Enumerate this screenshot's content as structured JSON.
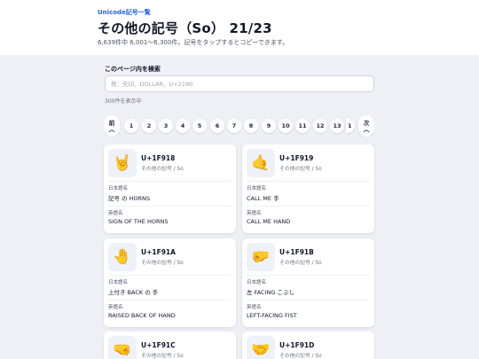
{
  "header": {
    "breadcrumb": "Unicode記号一覧",
    "title": "その他の記号（So） 21/23",
    "subtitle": "6,639件中 6,001〜6,300件。記号をタップするとコピーできます。"
  },
  "search": {
    "label": "このページ内を検索",
    "placeholder": "例：矢印、DOLLAR、U+2190",
    "value": "",
    "count": "300件を表示中"
  },
  "pagination": {
    "prev_label": "前",
    "next_label": "次",
    "pages": [
      "1",
      "2",
      "3",
      "4",
      "5",
      "6",
      "7",
      "8",
      "9",
      "10",
      "11",
      "12",
      "13",
      "1"
    ]
  },
  "labels": {
    "jp_name": "日本語名",
    "en_name": "英語名"
  },
  "cards": [
    {
      "symbol": "🤘",
      "code": "U+1F918",
      "category": "その他の記号 / So",
      "jp": "記号 の HORNS",
      "en": "SIGN OF THE HORNS"
    },
    {
      "symbol": "🤙",
      "code": "U+1F919",
      "category": "その他の記号 / So",
      "jp": "CALL ME 手",
      "en": "CALL ME HAND"
    },
    {
      "symbol": "🤚",
      "code": "U+1F91A",
      "category": "その他の記号 / So",
      "jp": "上付き BACK の 手",
      "en": "RAISED BACK OF HAND"
    },
    {
      "symbol": "🤛",
      "code": "U+1F91B",
      "category": "その他の記号 / So",
      "jp": "左 FACING こぶし",
      "en": "LEFT-FACING FIST"
    },
    {
      "symbol": "🤜",
      "code": "U+1F91C",
      "category": "その他の記号 / So",
      "jp": "",
      "en": ""
    },
    {
      "symbol": "🤝",
      "code": "U+1F91D",
      "category": "その他の記号 / So",
      "jp": "",
      "en": ""
    }
  ]
}
